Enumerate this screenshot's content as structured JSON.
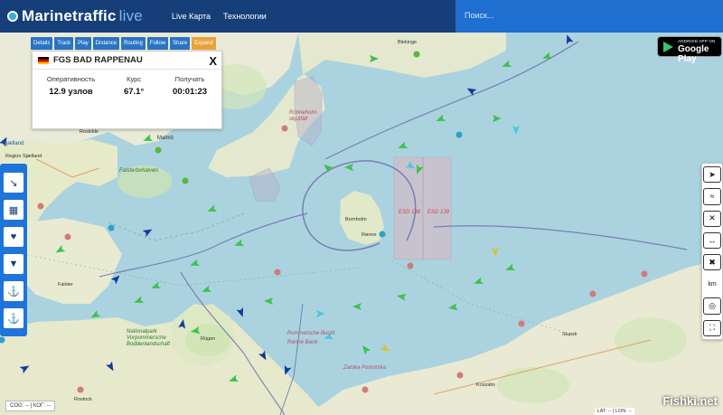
{
  "app": {
    "brand": "Marinetraffic",
    "brand_suffix": "live"
  },
  "nav": {
    "items": [
      "Live Карта",
      "Технологии"
    ]
  },
  "search": {
    "placeholder": "Поиск..."
  },
  "toolbar": {
    "buttons": [
      "Details",
      "Track",
      "Play",
      "Distance",
      "Routing",
      "Follow",
      "Share",
      "Expand"
    ]
  },
  "vessel_panel": {
    "name": "FGS BAD RAPPENAU",
    "flag": "Germany",
    "close_label": "X",
    "fields": [
      {
        "label": "Оперативность",
        "value": "12.9 узлов"
      },
      {
        "label": "Курс",
        "value": "67.1°"
      },
      {
        "label": "Получать",
        "value": "00:01:23"
      }
    ]
  },
  "google_play": {
    "line1": "ANDROID APP ON",
    "line2": "Google Play"
  },
  "left_controls": [
    "route-icon",
    "map-icon",
    "heart-icon",
    "filter-icon",
    "ship-icon",
    "anchor-icon"
  ],
  "right_controls": [
    "compass-icon",
    "sea-icon",
    "close-icon",
    "measure-icon",
    "close-icon",
    "km-unit",
    "locate-icon",
    "fullscreen-icon"
  ],
  "right_controls_text": {
    "km": "km"
  },
  "coords": {
    "left": "COG: -- | КОГ: --",
    "right": "LAT: -- | LON: --"
  },
  "watermark": "Fishki.net",
  "map_labels": {
    "sjaelland": "Sjælland",
    "zealand": "Region Sjælland",
    "malmo": "Malmö",
    "bornholm": "Bornholm",
    "rugen": "Rügen",
    "rostock": "Rostock",
    "slupsk": "Słupsk",
    "koszalin": "Koszalin",
    "falster": "Falster",
    "ronne": "Rønne",
    "roskilde": "Roskilde",
    "esd1": "ESD 138",
    "esd2": "ESD 139",
    "rbank": "Rønne Bank",
    "pomm": "Pommersche Bucht",
    "zatoka": "Zatoka Pomorska",
    "falsterbo": "Falsterbohalvøn",
    "nprk": "Nationalpark Vorpommersche Boddenlandschaft",
    "flak": "Rönneholm skjutfält",
    "blek": "Blekinge"
  }
}
